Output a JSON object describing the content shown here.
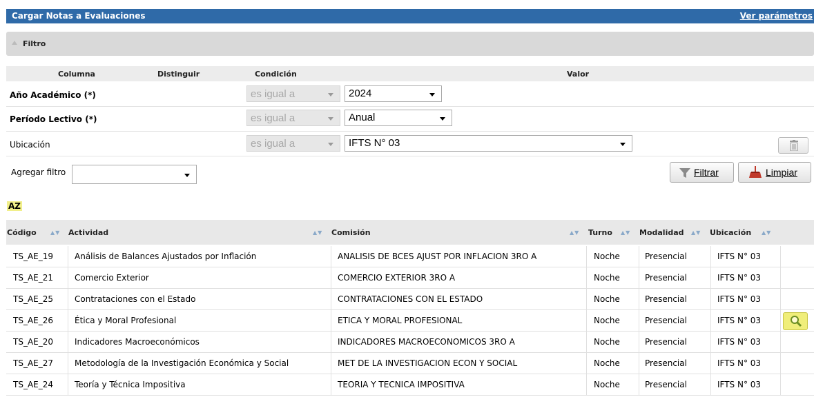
{
  "header": {
    "title": "Cargar Notas a Evaluaciones",
    "link": "Ver parámetros"
  },
  "filter": {
    "label": "Filtro",
    "columns": {
      "columna": "Columna",
      "distinguir": "Distinguir",
      "condicion": "Condición",
      "valor": "Valor"
    },
    "rows": [
      {
        "name": "Año Académico (*)",
        "condition": "es igual a",
        "value": "2024"
      },
      {
        "name": "Período Lectivo (*)",
        "condition": "es igual a",
        "value": "Anual"
      },
      {
        "name": "Ubicación",
        "condition": "es igual a",
        "value": "IFTS N° 03"
      }
    ],
    "add_filter_label": "Agregar filtro",
    "add_filter_value": "",
    "filtrar_label": "Filtrar",
    "limpiar_label": "Limpiar"
  },
  "sort_icon_label": "AZ",
  "table": {
    "headers": [
      "Código",
      "Actividad",
      "Comisión",
      "Turno",
      "Modalidad",
      "Ubicación"
    ],
    "rows": [
      [
        "TS_AE_19",
        "Análisis de Balances Ajustados por Inflación",
        "ANALISIS DE BCES AJUST POR INFLACION 3RO A",
        "Noche",
        "Presencial",
        "IFTS N° 03"
      ],
      [
        "TS_AE_21",
        "Comercio Exterior",
        "COMERCIO EXTERIOR 3RO A",
        "Noche",
        "Presencial",
        "IFTS N° 03"
      ],
      [
        "TS_AE_25",
        "Contrataciones con el Estado",
        "CONTRATACIONES CON EL ESTADO",
        "Noche",
        "Presencial",
        "IFTS N° 03"
      ],
      [
        "TS_AE_26",
        "Ética y Moral Profesional",
        "ETICA Y MORAL PROFESIONAL",
        "Noche",
        "Presencial",
        "IFTS N° 03"
      ],
      [
        "TS_AE_20",
        "Indicadores Macroeconómicos",
        "INDICADORES MACROECONOMICOS 3RO A",
        "Noche",
        "Presencial",
        "IFTS N° 03"
      ],
      [
        "TS_AE_27",
        "Metodología de la Investigación Económica y Social",
        "MET DE LA INVESTIGACION ECON Y SOCIAL",
        "Noche",
        "Presencial",
        "IFTS N° 03"
      ],
      [
        "TS_AE_24",
        "Teoría y Técnica Impositiva",
        "TEORIA Y TECNICA IMPOSITIVA",
        "Noche",
        "Presencial",
        "IFTS N° 03"
      ]
    ]
  },
  "colors": {
    "header_bg": "#2f6aa8",
    "highlight": "#f0ee7a"
  }
}
